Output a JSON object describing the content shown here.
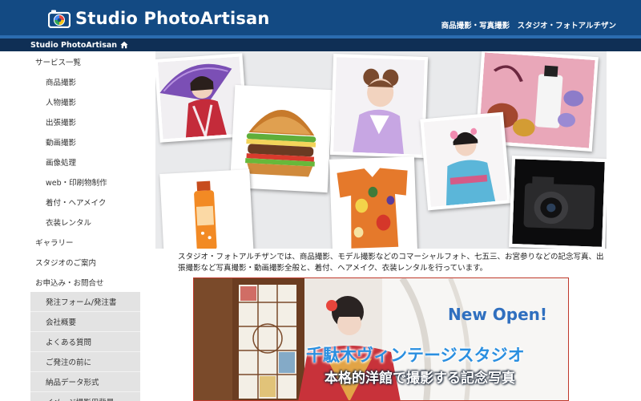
{
  "header": {
    "logo_text": "Studio PhotoArtisan",
    "tagline": "商品撮影・写真撮影　スタジオ・フォトアルチザン"
  },
  "breadcrumb": {
    "label": "Studio PhotoArtisan",
    "icon": "home-icon"
  },
  "sidebar": {
    "items": [
      {
        "label": "サービス一覧",
        "level": "top"
      },
      {
        "label": "商品撮影",
        "level": "sub"
      },
      {
        "label": "人物撮影",
        "level": "sub"
      },
      {
        "label": "出張撮影",
        "level": "sub"
      },
      {
        "label": "動画撮影",
        "level": "sub"
      },
      {
        "label": "画像処理",
        "level": "sub"
      },
      {
        "label": "web・印刷物制作",
        "level": "sub"
      },
      {
        "label": "着付・ヘアメイク",
        "level": "sub"
      },
      {
        "label": "衣装レンタル",
        "level": "sub"
      },
      {
        "label": "ギャラリー",
        "level": "top"
      },
      {
        "label": "スタジオのご案内",
        "level": "top"
      },
      {
        "label": "お申込み・お問合せ",
        "level": "top"
      }
    ],
    "secondary": [
      {
        "label": "発注フォーム/発注書"
      },
      {
        "label": "会社概要"
      },
      {
        "label": "よくある質問"
      },
      {
        "label": "ご発注の前に"
      },
      {
        "label": "納品データ形式"
      },
      {
        "label": "イメージ撮影用背景"
      }
    ]
  },
  "main": {
    "intro": "スタジオ・フォトアルチザンでは、商品撮影、モデル撮影などのコマーシャルフォト、七五三、お宮参りなどの記念写真、出張撮影など写真撮影・動画撮影全般と、着付、ヘアメイク、衣装レンタルを行っています。",
    "banner": {
      "badge": "New Open!",
      "title": "千駄木ヴィンテージスタジオ",
      "subtitle": "本格的洋館で撮影する記念写真"
    }
  },
  "colors": {
    "header_bg": "#134a83",
    "bar_bg": "#0f2f55",
    "accent_line": "#2b6cb0",
    "sidebar_secondary_bg": "#e3e3e3",
    "banner_badge": "#2f6fbf",
    "banner_title": "#2a8fe0",
    "banner_border": "#c0392b"
  }
}
